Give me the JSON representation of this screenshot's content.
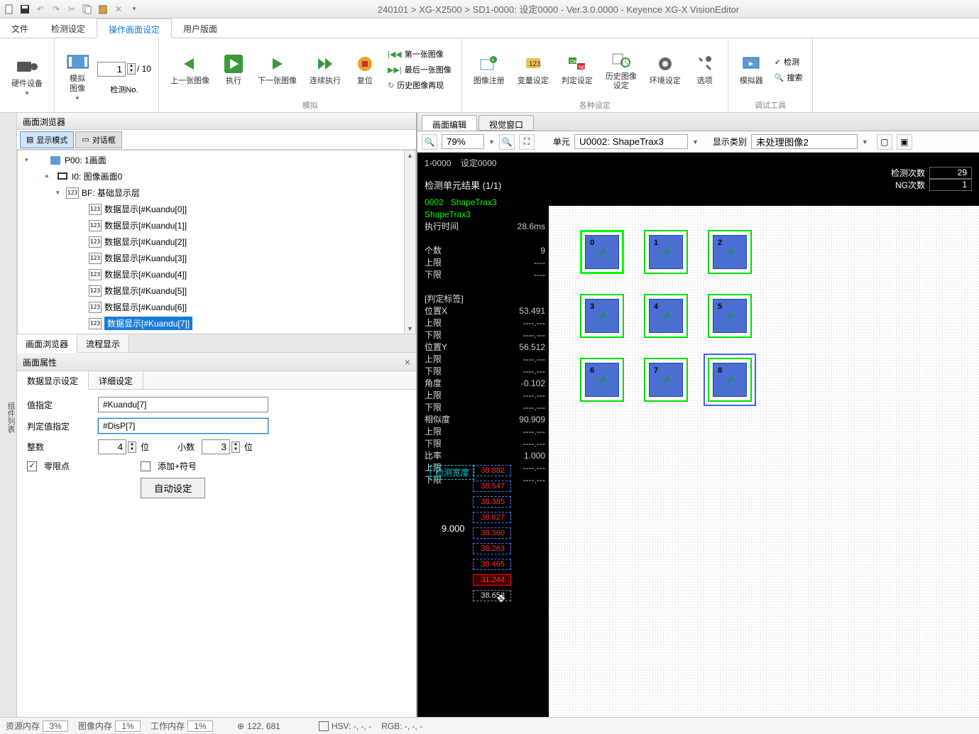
{
  "title": "240101 > XG-X2500 > SD1-0000: 设定0000 - Ver.3.0.0000 - Keyence XG-X VisionEditor",
  "menu": [
    "文件",
    "检测设定",
    "操作画面设定",
    "用户版面"
  ],
  "menu_active": 2,
  "ribbon": {
    "hardware": "硬件设备",
    "sim_image": "模拟\n图像",
    "test_spin": "1",
    "test_total": "/ 10",
    "test_no": "检测No.",
    "prev": "上一张图像",
    "exec": "执行",
    "next": "下一张图像",
    "cont": "连续执行",
    "reset": "复位",
    "first": "第一张图像",
    "last": "最后一张图像",
    "replay": "历史图像再现",
    "sim_group": "模拟",
    "img_reg": "图像注册",
    "var_set": "变量设定",
    "judge_set": "判定设定",
    "hist_img": "历史图像\n设定",
    "env_set": "环境设定",
    "options": "选项",
    "settings_group": "各种设定",
    "simulator": "模拟器",
    "search": "搜索",
    "debug_group": "调试工具"
  },
  "left_tab": "组件列表",
  "browser_title": "画面浏览器",
  "mode_display": "显示模式",
  "mode_dialog": "对话框",
  "tree": {
    "p00": "P00:  1画面",
    "i0": "I0: 图像画面0",
    "bf": "BF: 基础显示层",
    "items": [
      "数据显示[#Kuandu[0]]",
      "数据显示[#Kuandu[1]]",
      "数据显示[#Kuandu[2]]",
      "数据显示[#Kuandu[3]]",
      "数据显示[#Kuandu[4]]",
      "数据显示[#Kuandu[5]]",
      "数据显示[#Kuandu[6]]",
      "数据显示[#Kuandu[7]]"
    ],
    "selected": 7
  },
  "bottom_tabs": [
    "画面浏览器",
    "流程显示"
  ],
  "prop_title": "画面属性",
  "prop_tabs": [
    "数据显示设定",
    "详细设定"
  ],
  "props": {
    "value_label": "值指定",
    "value": "#Kuandu[7]",
    "judge_label": "判定值指定",
    "judge": "#DisP[7]",
    "int_label": "整数",
    "int_val": "4",
    "int_unit": "位",
    "dec_label": "小数",
    "dec_val": "3",
    "dec_unit": "位",
    "zero_label": "零限点",
    "plus_label": "添加+符号",
    "auto_btn": "自动设定"
  },
  "right_tabs": [
    "画面编辑",
    "视觉窗口"
  ],
  "view": {
    "zoom": "79%",
    "unit_label": "单元",
    "unit": "U0002: ShapeTrax3",
    "disp_label": "显示类别",
    "disp": "未处理图像2"
  },
  "canvas": {
    "header1": "1-0000",
    "header2": "设定0000",
    "result_title": "检测单元结果 (1/1)",
    "unit_id": "0002",
    "unit_name": "ShapeTrax3",
    "tool_name": "ShapeTrax3",
    "rows": [
      [
        "执行时间",
        "28.6ms"
      ],
      [
        "",
        ""
      ],
      [
        "个数",
        "9"
      ],
      [
        "  上限",
        "----"
      ],
      [
        "  下限",
        "----"
      ],
      [
        "",
        ""
      ],
      [
        "[判定标签]",
        ""
      ],
      [
        "位置X",
        "53.491"
      ],
      [
        "  上限",
        "----.---"
      ],
      [
        "  下限",
        "----.---"
      ],
      [
        "位置Y",
        "56.512"
      ],
      [
        "  上限",
        "----.---"
      ],
      [
        "  下限",
        "----.---"
      ],
      [
        "角度",
        "-0.102"
      ],
      [
        "  上限",
        "----.---"
      ],
      [
        "  下限",
        "----.---"
      ],
      [
        "相似度",
        "90.909"
      ],
      [
        "  上限",
        "----.---"
      ],
      [
        "  下限",
        "----.---"
      ],
      [
        "比率",
        "1.000"
      ],
      [
        "  上限",
        "----.---"
      ],
      [
        "  下限",
        "----.---"
      ]
    ],
    "stats": [
      [
        "检测次数",
        "29"
      ],
      [
        "NG次数",
        "1"
      ]
    ],
    "width_label": "检测宽度",
    "nine": "9.000",
    "width_vals": [
      "38.882",
      "38.547",
      "38.385",
      "38.627",
      "38.360",
      "38.263",
      "38.465",
      "31.244",
      "38.653"
    ]
  },
  "status": {
    "res_mem": "资源内存",
    "res_val": "3%",
    "img_mem": "图像内存",
    "img_val": "1%",
    "work_mem": "工作内存",
    "work_val": "1%",
    "coords": "122, 681",
    "hsv": "HSV: -, -, -",
    "rgb": "RGB: -, -, -"
  }
}
